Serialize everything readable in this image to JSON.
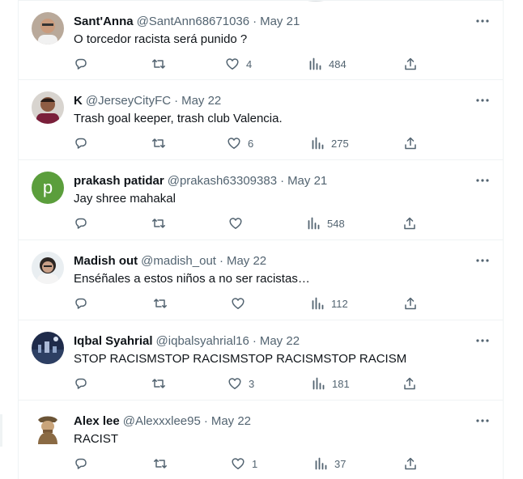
{
  "colors": {
    "text": "#0f1419",
    "muted": "#536471",
    "divider": "#eff3f4",
    "prakash_avatar": "#5b9e3c"
  },
  "icons": {
    "reply": "reply-icon",
    "repost": "repost-icon",
    "like": "heart-icon",
    "views": "views-icon",
    "share": "share-icon",
    "more": "more-icon"
  },
  "tweets": [
    {
      "name": "Sant'Anna",
      "handle": "@SantAnn68671036",
      "separator": "·",
      "date": "May 21",
      "text": "O torcedor racista será punido ?",
      "replies": "",
      "reposts": "",
      "likes": "4",
      "views": "484"
    },
    {
      "name": "K",
      "handle": "@JerseyCityFC",
      "separator": "·",
      "date": "May 22",
      "text": "Trash goal keeper, trash club Valencia.",
      "replies": "",
      "reposts": "",
      "likes": "6",
      "views": "275"
    },
    {
      "name": "prakash patidar",
      "handle": "@prakash63309383",
      "separator": "·",
      "date": "May 21",
      "text": "Jay shree mahakal",
      "avatar_letter": "p",
      "replies": "",
      "reposts": "",
      "likes": "",
      "views": "548"
    },
    {
      "name": "Madish out",
      "handle": "@madish_out",
      "separator": "·",
      "date": "May 22",
      "text": "Enséñales a estos niños a no ser racistas…",
      "replies": "",
      "reposts": "",
      "likes": "",
      "views": "112"
    },
    {
      "name": "Iqbal Syahrial",
      "handle": "@iqbalsyahrial16",
      "separator": "·",
      "date": "May 22",
      "text": "STOP RACISMSTOP RACISMSTOP RACISMSTOP RACISM",
      "replies": "",
      "reposts": "",
      "likes": "3",
      "views": "181"
    },
    {
      "name": "Alex lee",
      "handle": "@Alexxxlee95",
      "separator": "·",
      "date": "May 22",
      "text": "RACIST",
      "replies": "",
      "reposts": "",
      "likes": "1",
      "views": "37"
    }
  ]
}
